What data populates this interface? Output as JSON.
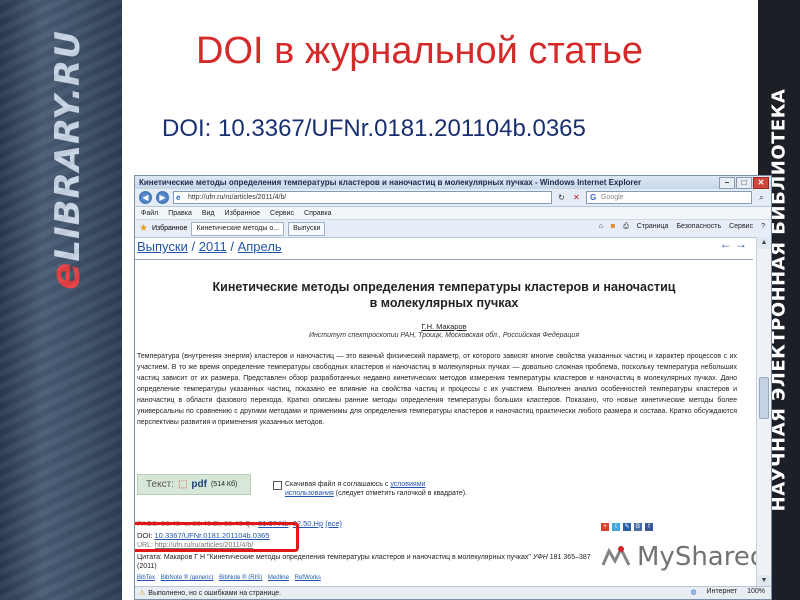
{
  "left_brand": {
    "e": "e",
    "library": "LIBRARY.RU"
  },
  "right_brand": "НАУЧНАЯ ЭЛЕКТРОННАЯ БИБЛИОТЕКА",
  "slide": {
    "title": "DOI в журнальной статье",
    "doi": "DOI: 10.3367/UFNr.0181.201104b.0365"
  },
  "window": {
    "title": "Кинетические методы определения температуры кластеров и наночастиц в молекулярных пучках - Windows Internet Explorer",
    "url": "http://ufn.ru/ru/articles/2011/4/b/",
    "search_placeholder": "Google",
    "menu": [
      "Файл",
      "Правка",
      "Вид",
      "Избранное",
      "Сервис",
      "Справка"
    ],
    "favorites_label": "Избранное",
    "tabs": [
      "Кинетические методы о...",
      "Выпуски"
    ],
    "commands": [
      "Страница",
      "Безопасность",
      "Сервис"
    ]
  },
  "page": {
    "breadcrumb": [
      "Выпуски",
      "/",
      "2011",
      "/",
      "Апрель"
    ],
    "nav_arrows": "←  →",
    "title_line1": "Кинетические методы определения температуры кластеров и наночастиц",
    "title_line2": "в молекулярных пучках",
    "author": "Г.Н. Макаров",
    "affiliation": "Институт спектроскопии РАН, Троицк, Московская обл., Российская Федерация",
    "abstract": "Температура (внутренняя энергия) кластеров и наночастиц — это важный физический параметр, от которого зависят многие свойства указанных частиц и характер процессов с их участием. В то же время определение температуры свободных кластеров и наночастиц в молекулярных пучках — довольно сложная проблема, поскольку температура небольших частиц зависит от их размера. Представлен обзор разработанных недавно кинетических методов измерения температуры кластеров и наночастиц в молекулярных пучках. Дано определение температуры указанных частиц, показано ее влияние на свойства частиц и процессы с их участием. Выполнен анализ особенностей температуры кластеров и наночастиц в области фазового перехода. Кратко описаны ранние методы определения температуры больших кластеров. Показано, что новые кинетические методы более универсальны по сравнению с другими методами и применимы для определения температуры кластеров и наночастиц практически любого размера и состава. Кратко обсуждаются перспективы развития и применения указанных методов.",
    "pdf_label": "Текст:",
    "pdf_link": "pdf",
    "pdf_size": "(514 Кб)",
    "agree_text_1": "Скачивая файл я соглашаюсь с",
    "agree_link": "условиями использования",
    "agree_text_2": "(следует отметить галочкой в квадрате).",
    "dl_prefix": "PACS: 36.40.-c, 36.40.Ei, 36.40.Qv",
    "dl_links": [
      "81.07.Nb",
      "82.50.Hp",
      "(все)"
    ],
    "doi_label": "DOI:",
    "doi_value": "10.3367/UFNr.0181.201104b.0365",
    "url_label": "URL:",
    "url_value": "http://ufn.ru/ru/articles/2011/4/b/",
    "cite_label": "Цитата:",
    "cite_text": "Макаров Г Н \"Кинетические методы определения температуры кластеров и наночастиц в молекулярных пучках\"",
    "cite_journal": "УФН",
    "cite_tail": "181 365–387 (2011)",
    "cite_links": [
      "BibTex",
      "BibNote ® (generic)",
      "BibNote ® (RIS)",
      "Medline",
      "RefWorks"
    ]
  },
  "watermark": "MyShared",
  "status": {
    "text": "Выполнено, но с ошибками на странице.",
    "zone": "Интернет",
    "zoom": "100%"
  },
  "colors": {
    "slide_title": "#d42a2a",
    "slide_doi": "#1a2f70",
    "highlight": "#e01818",
    "link": "#2255aa"
  }
}
